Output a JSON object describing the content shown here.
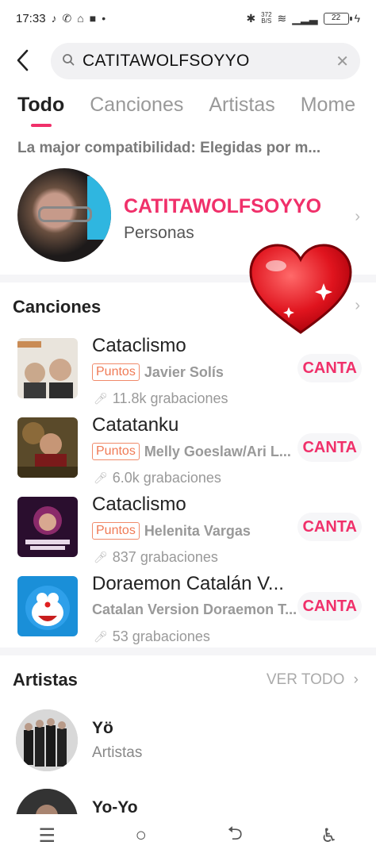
{
  "status_bar": {
    "time": "17:33",
    "net_speed_top": "372",
    "net_speed_bottom": "B/S",
    "battery": "22"
  },
  "search": {
    "query": "CATITAWOLFSOYYO",
    "back_icon": "back-arrow-icon",
    "clear_icon": "clear-icon"
  },
  "tabs": [
    {
      "label": "Todo",
      "active": true
    },
    {
      "label": "Canciones",
      "active": false
    },
    {
      "label": "Artistas",
      "active": false
    },
    {
      "label": "Mome",
      "active": false
    }
  ],
  "best_match": {
    "heading": "La major compatibilidad: Elegidas por m...",
    "name": "CATITAWOLFSOYYO",
    "type": "Personas"
  },
  "songs_section": {
    "title": "Canciones",
    "items": [
      {
        "title": "Cataclismo",
        "tag": "Puntos",
        "artist": "Javier Solís",
        "count": "11.8k grabaciones",
        "action": "CANTA"
      },
      {
        "title": "Catatanku",
        "tag": "Puntos",
        "artist": "Melly Goeslaw/Ari L...",
        "count": "6.0k grabaciones",
        "action": "CANTA"
      },
      {
        "title": "Cataclismo",
        "tag": "Puntos",
        "artist": "Helenita Vargas",
        "count": "837 grabaciones",
        "action": "CANTA"
      },
      {
        "title": "Doraemon Catalán V...",
        "tag": "",
        "artist": "Catalan Version Doraemon T...",
        "count": "53 grabaciones",
        "action": "CANTA"
      }
    ]
  },
  "artists_section": {
    "title": "Artistas",
    "see_all": "VER TODO",
    "items": [
      {
        "name": "Yö",
        "type": "Artistas"
      },
      {
        "name": "Yo-Yo",
        "type": ""
      }
    ]
  },
  "colors": {
    "accent": "#f0306a",
    "tag": "#f07a55",
    "muted": "#999999"
  }
}
